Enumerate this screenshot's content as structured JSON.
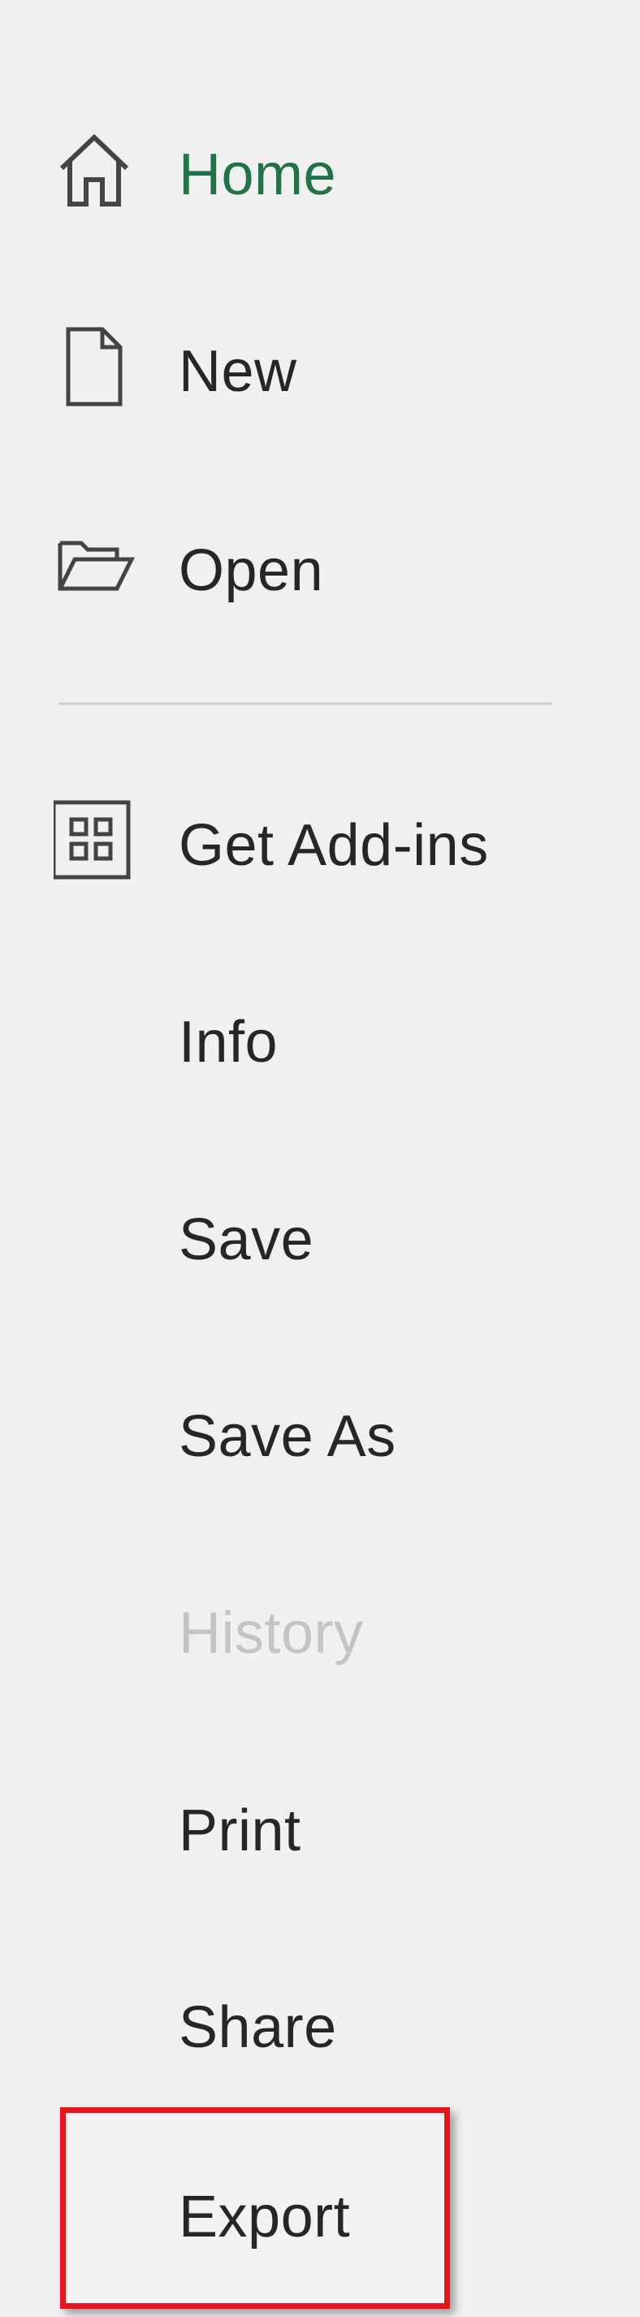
{
  "nav": {
    "items": [
      {
        "label": "Home",
        "icon": "home-icon",
        "state": "active"
      },
      {
        "label": "New",
        "icon": "new-document-icon",
        "state": "normal"
      },
      {
        "label": "Open",
        "icon": "open-folder-icon",
        "state": "normal"
      },
      {
        "label": "Get Add-ins",
        "icon": "add-ins-grid-icon",
        "state": "normal"
      },
      {
        "label": "Info",
        "state": "normal"
      },
      {
        "label": "Save",
        "state": "normal"
      },
      {
        "label": "Save As",
        "state": "normal"
      },
      {
        "label": "History",
        "state": "disabled"
      },
      {
        "label": "Print",
        "state": "normal"
      },
      {
        "label": "Share",
        "state": "normal"
      },
      {
        "label": "Export",
        "state": "highlighted"
      }
    ]
  },
  "colors": {
    "background": "#f0f0f0",
    "active_text": "#217346",
    "text": "#262626",
    "disabled_text": "#c4c4c4",
    "divider": "#d2d2d2",
    "highlight_border": "#e8141c"
  }
}
